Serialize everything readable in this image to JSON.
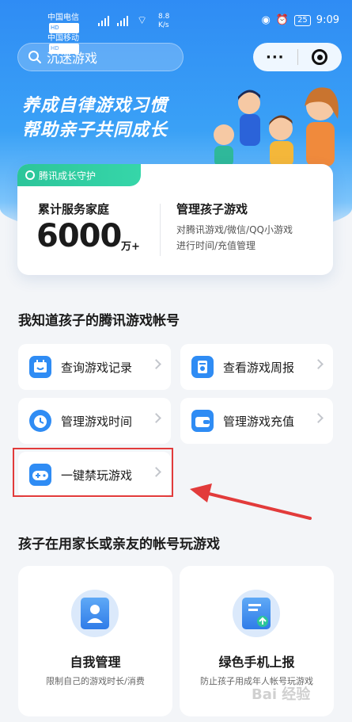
{
  "status_bar": {
    "carrier1": "中国电信",
    "carrier2": "中国移动",
    "hd": "HD",
    "net_speed": "8.8",
    "net_unit": "K/s",
    "battery": "25",
    "time": "9:09"
  },
  "search": {
    "placeholder": "沉迷游戏"
  },
  "capsule": {
    "more": "···"
  },
  "hero": {
    "line1": "养成自律游戏习惯",
    "line2": "帮助亲子共同成长"
  },
  "guard_card": {
    "tag": "腾讯成长守护",
    "stat_label": "累计服务家庭",
    "stat_value": "6000",
    "stat_unit": "万+",
    "manage_title": "管理孩子游戏",
    "manage_desc1": "对腾讯游戏/微信/QQ小游戏",
    "manage_desc2": "进行时间/充值管理"
  },
  "section1": {
    "title": "我知道孩子的腾讯游戏帐号",
    "tiles": [
      {
        "label": "查询游戏记录",
        "icon": "calendar-icon"
      },
      {
        "label": "查看游戏周报",
        "icon": "report-icon"
      },
      {
        "label": "管理游戏时间",
        "icon": "alarm-clock-icon"
      },
      {
        "label": "管理游戏充值",
        "icon": "wallet-icon"
      },
      {
        "label": "一键禁玩游戏",
        "icon": "gamepad-icon"
      }
    ]
  },
  "section2": {
    "title": "孩子在用家长或亲友的帐号玩游戏",
    "cards": [
      {
        "title": "自我管理",
        "desc": "限制自己的游戏时长/消费",
        "icon": "self-manage-icon"
      },
      {
        "title": "绿色手机上报",
        "desc": "防止孩子用成年人帐号玩游戏",
        "icon": "phone-report-icon"
      }
    ]
  },
  "watermark": "Bai 经验",
  "colors": {
    "primary": "#2f8cf4",
    "accent_green": "#2cc59a",
    "highlight_red": "#e23b3b"
  }
}
